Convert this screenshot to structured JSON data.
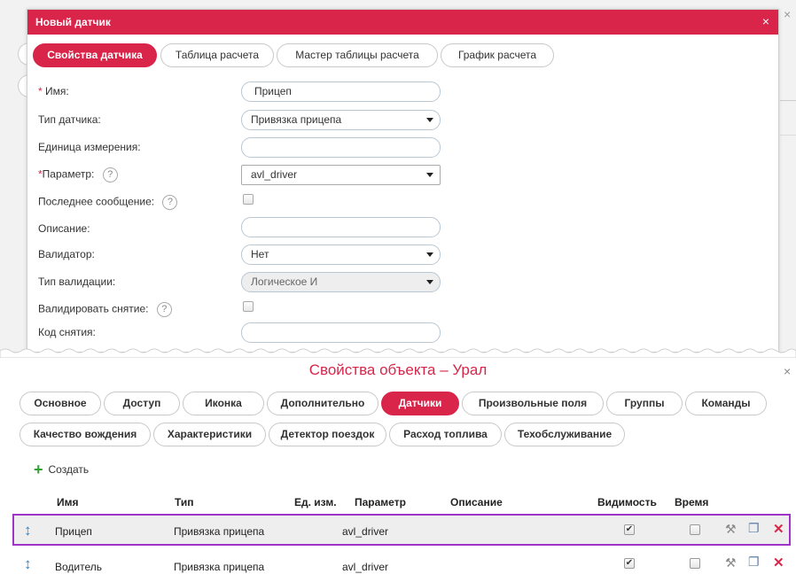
{
  "sensor_dialog": {
    "title": "Новый датчик",
    "close": "×",
    "tabs": [
      "Свойства датчика",
      "Таблица расчета",
      "Мастер таблицы расчета",
      "График расчета"
    ],
    "fields": {
      "name_label": "Имя:",
      "name_required": "*",
      "name_value": "Прицеп",
      "type_label": "Тип датчика:",
      "type_value": "Привязка прицепа",
      "unit_label": "Единица измерения:",
      "unit_value": "",
      "param_label": "Параметр:",
      "param_required": "*",
      "param_value": "avl_driver",
      "last_msg_label": "Последнее сообщение:",
      "description_label": "Описание:",
      "description_value": "",
      "validator_label": "Валидатор:",
      "validator_value": "Нет",
      "validation_type_label": "Тип валидации:",
      "validation_type_value": "Логическое И",
      "validate_unbind_label": "Валидировать снятие:",
      "unbind_code_label": "Код снятия:",
      "unbind_code_value": ""
    },
    "help_glyph": "?"
  },
  "object_dialog": {
    "title": "Свойства объекта – Урал",
    "close": "×",
    "tabs_row1": [
      "Основное",
      "Доступ",
      "Иконка",
      "Дополнительно",
      "Датчики",
      "Произвольные поля",
      "Группы",
      "Команды"
    ],
    "tabs_row2": [
      "Качество вождения",
      "Характеристики",
      "Детектор поездок",
      "Расход топлива",
      "Техобслуживание"
    ],
    "active_tab": "Датчики",
    "create_icon": "+",
    "create_label": "Создать",
    "columns": [
      "Имя",
      "Тип",
      "Ед. изм.",
      "Параметр",
      "Описание",
      "Видимость",
      "Время"
    ],
    "rows": [
      {
        "name": "Прицеп",
        "type": "Привязка прицепа",
        "unit": "",
        "param": "avl_driver",
        "description": "",
        "visible": true,
        "time": false,
        "selected": true
      },
      {
        "name": "Водитель",
        "type": "Привязка прицепа",
        "unit": "",
        "param": "avl_driver",
        "description": "",
        "visible": true,
        "time": false,
        "selected": false
      }
    ]
  },
  "colors": {
    "accent": "#d9254a",
    "selection_border": "#a033c8",
    "drag_icon": "#2a86c8",
    "create_icon": "#2fa32f"
  },
  "icons": {
    "drag": "↕",
    "wrench": "🔧",
    "copy": "❐",
    "delete": "✕",
    "check": "✔"
  }
}
